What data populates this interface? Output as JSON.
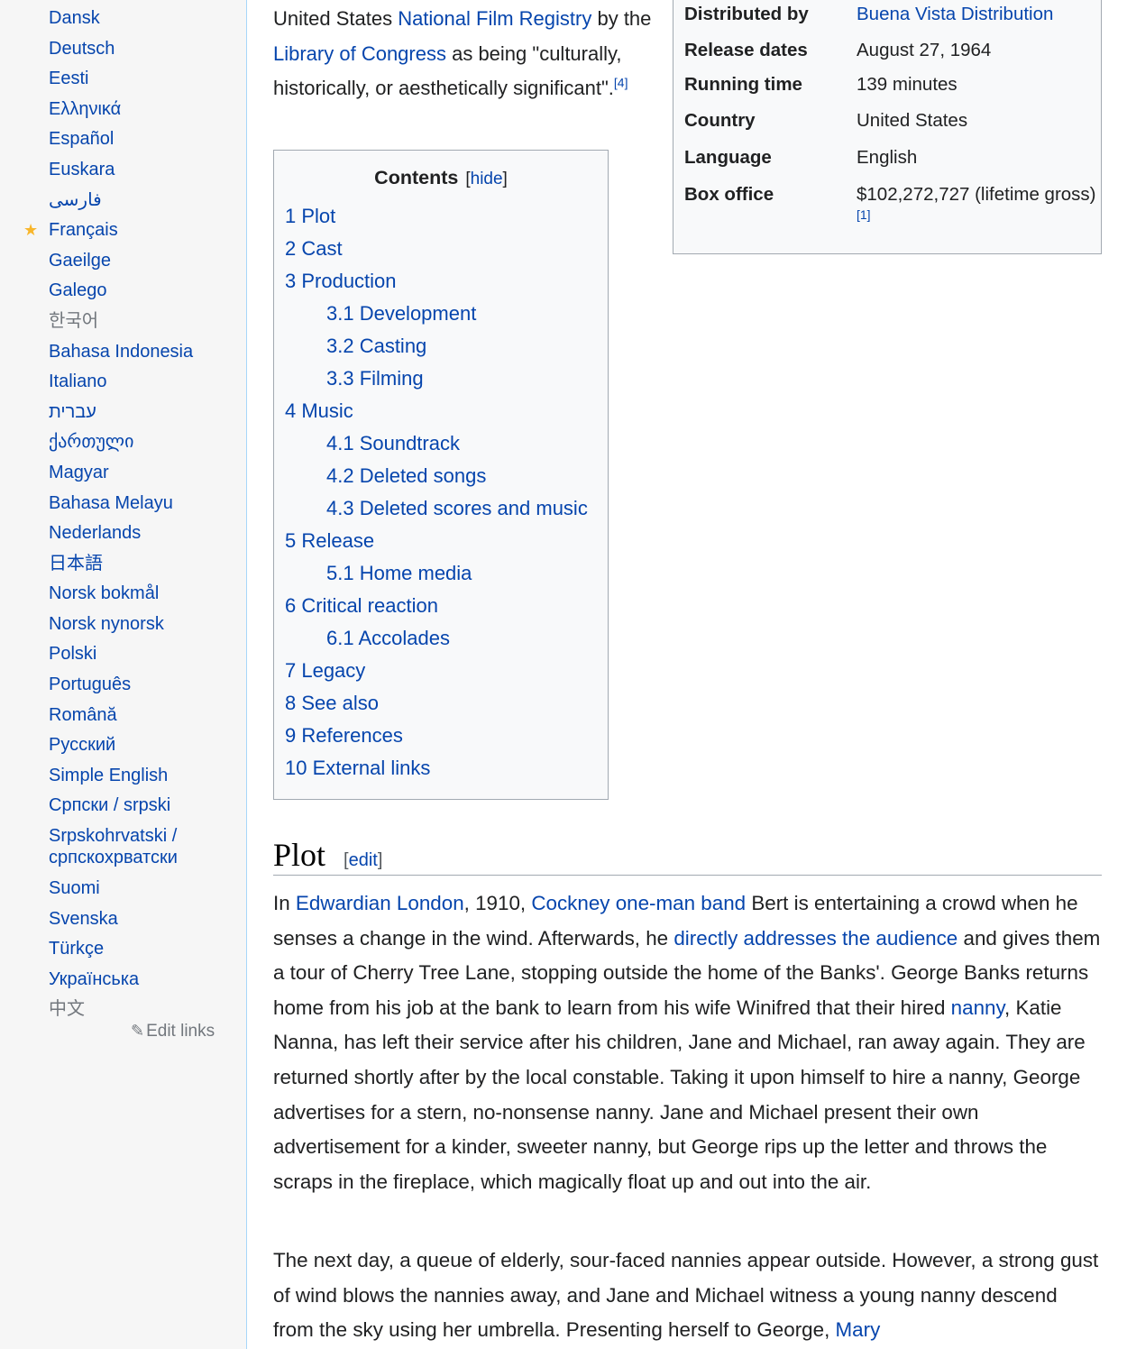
{
  "sidebar": {
    "languages": [
      {
        "label": "Dansk"
      },
      {
        "label": "Deutsch"
      },
      {
        "label": "Eesti"
      },
      {
        "label": "Ελληνικά"
      },
      {
        "label": "Español"
      },
      {
        "label": "Euskara"
      },
      {
        "label": "فارسی"
      },
      {
        "label": "Français",
        "featured": true
      },
      {
        "label": "Gaeilge"
      },
      {
        "label": "Galego"
      },
      {
        "label": "한국어"
      },
      {
        "label": "Bahasa Indonesia"
      },
      {
        "label": "Italiano"
      },
      {
        "label": "עברית"
      },
      {
        "label": "ქართული"
      },
      {
        "label": "Magyar"
      },
      {
        "label": "Bahasa Melayu"
      },
      {
        "label": "Nederlands"
      },
      {
        "label": "日本語"
      },
      {
        "label": "Norsk bokmål"
      },
      {
        "label": "Norsk nynorsk"
      },
      {
        "label": "Polski"
      },
      {
        "label": "Português"
      },
      {
        "label": "Română"
      },
      {
        "label": "Русский"
      },
      {
        "label": "Simple English"
      },
      {
        "label": "Српски / srpski"
      },
      {
        "label": "Srpskohrvatski / српскохрватски"
      },
      {
        "label": "Suomi"
      },
      {
        "label": "Svenska"
      },
      {
        "label": "Türkçe"
      },
      {
        "label": "Українська"
      },
      {
        "label": "中文"
      }
    ],
    "edit_links": "Edit links"
  },
  "intro": {
    "text_1": "United States ",
    "link_1": "National Film Registry",
    "text_2": " by the ",
    "link_2": "Library of Congress",
    "text_3": " as being \"culturally, historically, or aesthetically significant\".",
    "ref": "[4]"
  },
  "infobox": {
    "rows": [
      {
        "label": "Distributed by",
        "value": "Buena Vista Distribution",
        "link": true
      },
      {
        "label": "Release dates",
        "value": "August 27, 1964"
      },
      {
        "label": "Running time",
        "value": "139 minutes"
      },
      {
        "label": "Country",
        "value": "United States"
      },
      {
        "label": "Language",
        "value": "English"
      },
      {
        "label": "Box office",
        "value": "$102,272,727 (lifetime gross)",
        "ref": "[1]"
      }
    ]
  },
  "toc": {
    "title": "Contents",
    "hide_label": "hide",
    "items": [
      {
        "label": "1 Plot",
        "level": 1
      },
      {
        "label": "2 Cast",
        "level": 1
      },
      {
        "label": "3 Production",
        "level": 1
      },
      {
        "label": "3.1 Development",
        "level": 2
      },
      {
        "label": "3.2 Casting",
        "level": 2
      },
      {
        "label": "3.3 Filming",
        "level": 2
      },
      {
        "label": "4 Music",
        "level": 1
      },
      {
        "label": "4.1 Soundtrack",
        "level": 2
      },
      {
        "label": "4.2 Deleted songs",
        "level": 2
      },
      {
        "label": "4.3 Deleted scores and music",
        "level": 2
      },
      {
        "label": "5 Release",
        "level": 1
      },
      {
        "label": "5.1 Home media",
        "level": 2
      },
      {
        "label": "6 Critical reaction",
        "level": 1
      },
      {
        "label": "6.1 Accolades",
        "level": 2
      },
      {
        "label": "7 Legacy",
        "level": 1
      },
      {
        "label": "8 See also",
        "level": 1
      },
      {
        "label": "9 References",
        "level": 1
      },
      {
        "label": "10 External links",
        "level": 1
      }
    ]
  },
  "plot": {
    "heading": "Plot",
    "edit_label": "edit",
    "p1": [
      {
        "t": "In "
      },
      {
        "t": "Edwardian London",
        "link": true
      },
      {
        "t": ", 1910, "
      },
      {
        "t": "Cockney one-man band",
        "link": true
      },
      {
        "t": " Bert is entertaining a crowd when he senses a change in the wind. Afterwards, he "
      },
      {
        "t": "directly addresses the audience",
        "link": true
      },
      {
        "t": " and gives them a tour of Cherry Tree Lane, stopping outside the home of the Banks'. George Banks returns home from his job at the bank to learn from his wife Winifred that their hired "
      },
      {
        "t": "nanny",
        "link": true
      },
      {
        "t": ", Katie Nanna, has left their service after his children, Jane and Michael, ran away again. They are returned shortly after by the local constable. Taking it upon himself to hire a nanny, George advertises for a stern, no-nonsense nanny. Jane and Michael present their own advertisement for a kinder, sweeter nanny, but George rips up the letter and throws the scraps in the fireplace, which magically float up and out into the air."
      }
    ],
    "p2": [
      {
        "t": "The next day, a queue of elderly, sour-faced nannies appear outside. However, a strong gust of wind blows the nannies away, and Jane and Michael witness a young nanny descend from the sky using her umbrella. Presenting herself to George, "
      },
      {
        "t": "Mary",
        "link": true
      }
    ]
  }
}
